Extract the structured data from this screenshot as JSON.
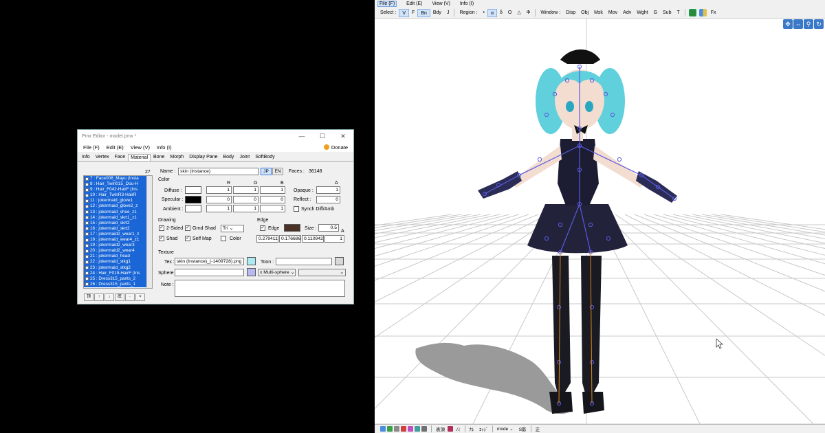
{
  "pmx_editor": {
    "title": "Pmx Editor - model.pmx *",
    "window_buttons": [
      "—",
      "☐",
      "✕"
    ],
    "menu": [
      "File (F)",
      "Edit (E)",
      "View (V)",
      "Info (I)"
    ],
    "donate": "Donate",
    "tabs": [
      "Info",
      "Vertex",
      "Face",
      "Material",
      "Bone",
      "Morph",
      "Display Pane",
      "Body",
      "Joint",
      "SoftBody"
    ],
    "active_tab": "Material",
    "material_count": "27",
    "materials": [
      "7 : Face008_Mayu (Insta",
      "8 : Hair_Twin015_Dou-H",
      "9 : Hair_F042-HairF (Ins",
      "10 : Hair_TwinR3-HairR",
      "11 : jokermaid_glove1",
      "12 : jokermaid_glove2_z",
      "13 : jokermaid_shoe_z1",
      "14 : jokermaid_skrt1_z1",
      "15 : jokermaid_skrt2",
      "16 : jokermaid_skrt2",
      "17 : jokermaid2_wear1_z",
      "18 : jokermaid_wear4_z1",
      "19 : jokermaid2_wear3",
      "20 : jokermaid2_wear4",
      "21 : jokermaid_head",
      "22 : jokermaid_stkg1",
      "23 : jokermaid_stkg2",
      "24 : Hair_F019-HairF (Ins",
      "25 : Dress315_pants_2",
      "26 : Dress315_pants_1"
    ],
    "list_buttons": [
      "顶",
      "↑",
      "↓",
      "底",
      "·",
      "×"
    ],
    "name_label": "Name :",
    "name_value": "skin (Instance)",
    "jp_label": "JP",
    "en_label": "EN",
    "faces_label": "Faces :",
    "faces_value": "36148",
    "color_section": "Color",
    "rgb_headers": [
      "R",
      "G",
      "B",
      "A"
    ],
    "diffuse_label": "Diffuse :",
    "diffuse_values": [
      "1",
      "1",
      "1"
    ],
    "specular_label": "Specular :",
    "specular_values": [
      "0",
      "0",
      "0"
    ],
    "ambient_label": "Ambient :",
    "ambient_values": [
      "1",
      "1",
      "1"
    ],
    "opaque_label": "Opaque :",
    "opaque_value": "1",
    "reflect_label": "Reflect :",
    "reflect_value": "0",
    "synch_label": "Synch Diff/Amb",
    "drawing_section": "Drawing",
    "two_sided": "2-Sided",
    "gnd_shad": "Grnd Shad",
    "tri_select": "Tri",
    "shad": "Shad",
    "self_map": "Self Map",
    "color_chk": "Color",
    "edge_section": "Edge",
    "edge_chk": "Edge",
    "size_label": "Size :",
    "size_value": "0.5",
    "edge_values": [
      "0.279411",
      "0.176686",
      "0.110942",
      "1"
    ],
    "edge_a": "A",
    "texture_section": "Texture",
    "tex_label": "Tex :",
    "tex_value": "skin (Instance)_(-1409728).png",
    "toon_label": "Toon :",
    "sphere_label": "Sphere :",
    "sphere_mode": "x Multi-sphere",
    "note_label": "Note :",
    "colors": {
      "diffuse": "#ffffff",
      "specular": "#000000",
      "ambient": "#ffffff",
      "edge": "#4a3226",
      "tex_swatch": "#aeeaf4",
      "sphere_swatch": "#b9b9f2",
      "toon_swatch": "#d8d8d8",
      "selection": "#1a66d6"
    }
  },
  "viewer": {
    "menu": [
      "File (F)",
      "Edit (E)",
      "View (V)",
      "Info (I)"
    ],
    "active_menu": "File (F)",
    "toolbar": {
      "select_label": "Select :",
      "select_items": [
        "V",
        "F",
        "Bn",
        "Bdy",
        "J"
      ],
      "region_label": "Region :",
      "region_items": [
        "•",
        "α",
        "δ",
        "O",
        "△",
        "Φ"
      ],
      "window_label": "Window :",
      "window_items": [
        "Disp",
        "Obj",
        "Msk",
        "Mov",
        "Adv",
        "Wght",
        "G",
        "Sub",
        "T"
      ],
      "fx_label": "Fx"
    },
    "nav_icons": [
      "move-icon",
      "pan-icon",
      "zoom-icon",
      "rotate-icon"
    ],
    "status": {
      "items": [
        "表頂",
        "ﾉﾐ",
        "ﾅﾙ",
        "ｴｯｼﾞ",
        "mode",
        "S影",
        "正"
      ],
      "mode_label": "mode"
    },
    "colors": {
      "grid": "#c8c8c8",
      "hair": "#5fd0dc",
      "dress": "#1c1d33",
      "bone": "#5a5adf",
      "shadow": "#9a9a9a"
    }
  }
}
